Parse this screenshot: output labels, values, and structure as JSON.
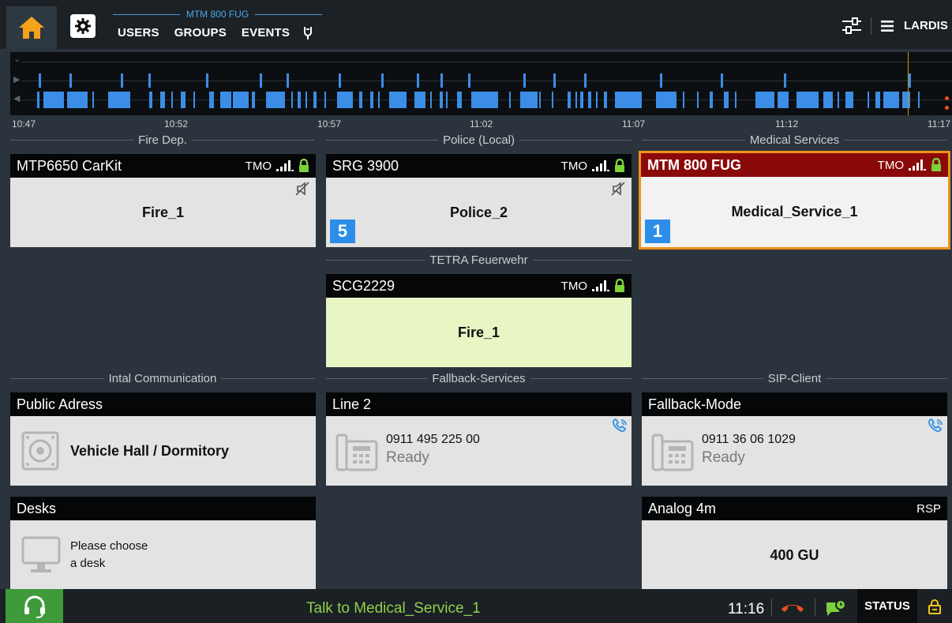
{
  "header": {
    "device_label": "MTM 800 FUG",
    "nav": [
      "USERS",
      "GROUPS",
      "EVENTS"
    ],
    "brand": "LARDIS"
  },
  "timeline": {
    "time_labels": [
      "10:47",
      "10:52",
      "10:57",
      "11:02",
      "11:07",
      "11:12",
      "11:17"
    ]
  },
  "groups": {
    "fire": "Fire Dep.",
    "police": "Police (Local)",
    "medical": "Medical Services",
    "tetra": "TETRA Feuerwehr",
    "intal": "Intal Communication",
    "fallback": "Fallback-Services",
    "sip": "SIP-Client"
  },
  "cards": {
    "mtp6650": {
      "title": "MTP6650 CarKit",
      "network": "TMO",
      "talkgroup": "Fire_1"
    },
    "srg3900": {
      "title": "SRG 3900",
      "network": "TMO",
      "talkgroup": "Police_2",
      "badge": "5"
    },
    "mtm800": {
      "title": "MTM 800 FUG",
      "network": "TMO",
      "talkgroup": "Medical_Service_1",
      "badge": "1"
    },
    "scg2229": {
      "title": "SCG2229",
      "network": "TMO",
      "talkgroup": "Fire_1"
    },
    "public_adress": {
      "title": "Public Adress",
      "text": "Vehicle Hall / Dormitory"
    },
    "line2": {
      "title": "Line 2",
      "number": "0911 495 225 00",
      "state": "Ready"
    },
    "fallback_mode": {
      "title": "Fallback-Mode",
      "number": "0911 36 06 1029",
      "state": "Ready"
    },
    "desks": {
      "title": "Desks",
      "line1": "Please choose",
      "line2": "a desk"
    },
    "analog": {
      "title": "Analog 4m",
      "network": "RSP",
      "talkgroup": "400 GU"
    }
  },
  "footer": {
    "talk_text": "Talk to Medical_Service_1",
    "clock": "11:16",
    "status_label": "STATUS"
  },
  "colors": {
    "accent_orange": "#f0901a",
    "active_header": "#8a0a0a",
    "badge_blue": "#2c8ee8",
    "lock_green": "#7bd23a",
    "talk_green": "#8ed04a"
  }
}
